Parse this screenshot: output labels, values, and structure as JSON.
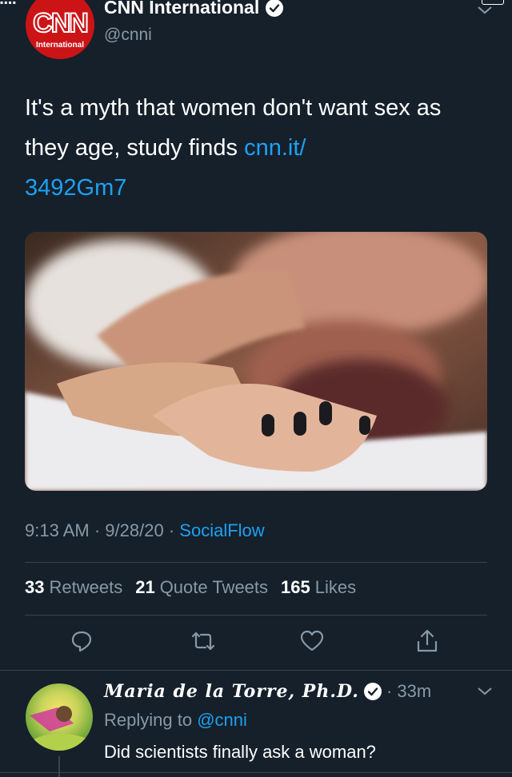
{
  "tweet": {
    "author": {
      "name": "CNN International",
      "handle": "@cnni",
      "logo_text": "CNN",
      "logo_sub": "International"
    },
    "text_plain": "It's a myth that women don't want sex as they age, study finds ",
    "text_link": "cnn.it/\n3492Gm7",
    "time": "9:13 AM",
    "date": "9/28/20",
    "separator": "·",
    "source": "SocialFlow",
    "stats": {
      "retweets_count": "33",
      "retweets_label": "Retweets",
      "quotes_count": "21",
      "quotes_label": "Quote Tweets",
      "likes_count": "165",
      "likes_label": "Likes"
    }
  },
  "reply": {
    "name": "Maria de la Torre, Ph.D.",
    "time": "· 33m",
    "replying_prefix": "Replying to",
    "replying_to": "@cnni",
    "text": "Did scientists finally ask a woman?"
  },
  "colors": {
    "background": "#15202b",
    "accent": "#1da1f2",
    "muted": "#8899a6",
    "divider": "#38444d",
    "cnn_red": "#cc1417"
  },
  "icons": [
    "verified-badge-icon",
    "chevron-down-icon",
    "reply-icon",
    "retweet-icon",
    "like-icon",
    "share-icon"
  ]
}
